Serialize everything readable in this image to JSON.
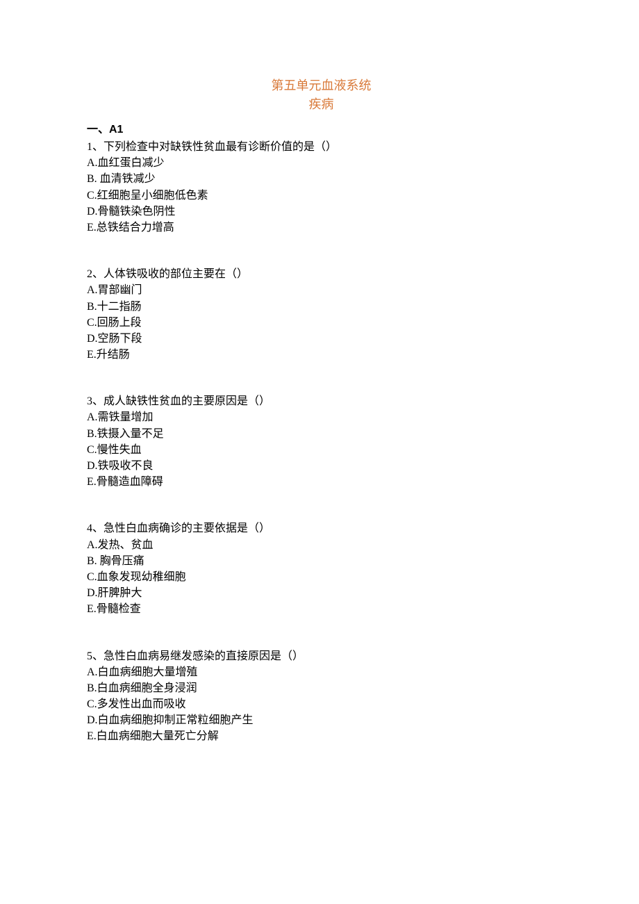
{
  "title": {
    "line1": "第五单元血液系统",
    "line2": "疾病"
  },
  "section_header": "一、A1",
  "questions": [
    {
      "stem": "1、下列检查中对缺铁性贫血最有诊断价值的是（）",
      "options": [
        "A.血红蛋白减少",
        "B. 血清铁减少",
        "C.红细胞呈小细胞低色素",
        "D.骨髓铁染色阴性",
        "E.总铁结合力增高"
      ]
    },
    {
      "stem": "2、人体铁吸收的部位主要在（）",
      "options": [
        "A.胃部幽门",
        "B.十二指肠",
        "C.回肠上段",
        "D.空肠下段",
        "E.升结肠"
      ]
    },
    {
      "stem": "3、成人缺铁性贫血的主要原因是（）",
      "options": [
        "A.需铁量增加",
        "B.铁摄入量不足",
        "C.慢性失血",
        "D.铁吸收不良",
        "E.骨髓造血障碍"
      ]
    },
    {
      "stem": "4、急性白血病确诊的主要依据是（）",
      "options": [
        "A.发热、贫血",
        "B. 胸骨压痛",
        "C.血象发现幼稚细胞",
        "D.肝脾肿大",
        "E.骨髓检查"
      ]
    },
    {
      "stem": "5、急性白血病易继发感染的直接原因是（）",
      "options": [
        "A.白血病细胞大量增殖",
        "B.白血病细胞全身浸润",
        "C.多发性出血而吸收",
        "D.白血病细胞抑制正常粒细胞产生",
        "E.白血病细胞大量死亡分解"
      ]
    }
  ]
}
